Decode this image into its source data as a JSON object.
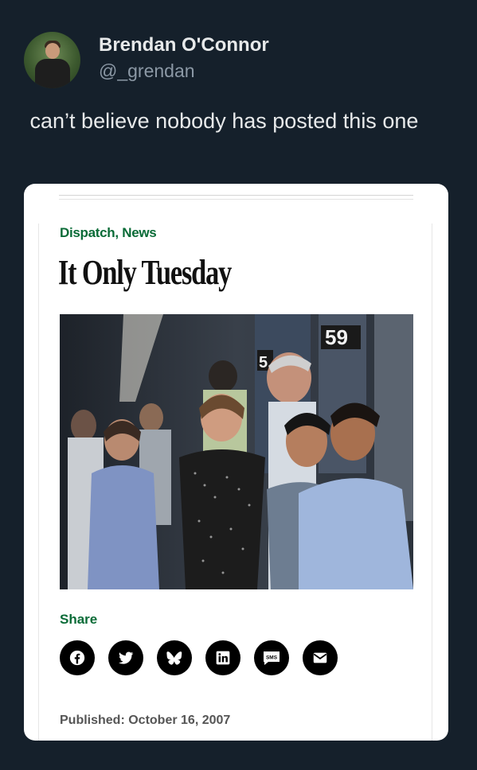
{
  "tweet": {
    "display_name": "Brendan O'Connor",
    "handle": "@_grendan",
    "text": " can’t believe nobody has posted this one"
  },
  "card": {
    "category": "Dispatch, News",
    "headline": "It Only Tuesday",
    "photo_sign": "59",
    "photo_sign_partial": "5",
    "share_label": "Share",
    "share_buttons": [
      {
        "icon": "facebook-icon"
      },
      {
        "icon": "twitter-icon"
      },
      {
        "icon": "bluesky-icon"
      },
      {
        "icon": "linkedin-icon"
      },
      {
        "icon": "sms-icon",
        "label": "SMS"
      },
      {
        "icon": "email-icon"
      }
    ],
    "published": "Published: October 16, 2007"
  },
  "colors": {
    "background": "#15202b",
    "accent_green": "#0a6b37"
  }
}
